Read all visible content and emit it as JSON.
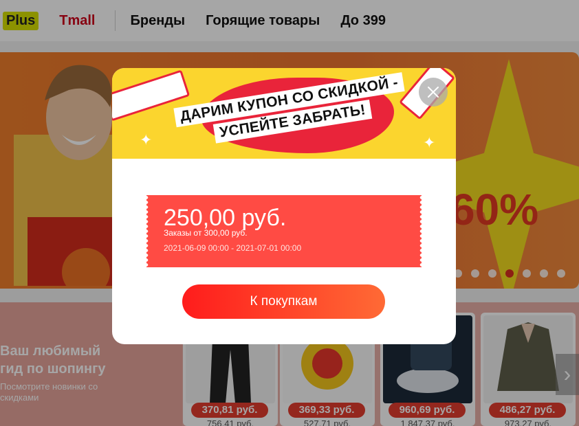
{
  "nav": {
    "items": [
      "Plus",
      "Tmall",
      "Бренды",
      "Горящие товары",
      "До 399"
    ]
  },
  "banner": {
    "percent_text": "60%",
    "slide_count": 7,
    "active_slide": 4
  },
  "promo": {
    "title": "Ваш любимый гид по шопингу",
    "subtitle": "Посмотрите новинки со скидками"
  },
  "products": [
    {
      "price": "370,81 руб.",
      "old_price": "756,41 руб."
    },
    {
      "price": "369,33 руб.",
      "old_price": "527,71 руб."
    },
    {
      "price": "960,69 руб.",
      "old_price": "1 847,37 руб."
    },
    {
      "price": "486,27 руб.",
      "old_price": "973,27 руб."
    }
  ],
  "modal": {
    "title_line1": "ДАРИМ КУПОН СО СКИДКОЙ -",
    "title_line2": "УСПЕЙТЕ ЗАБРАТЬ!",
    "coupon_amount": "250,00 руб.",
    "coupon_condition": "Заказы от 300,00 руб.",
    "coupon_dates": "2021-06-09 00:00 - 2021-07-01 00:00",
    "button_label": "К покупкам"
  },
  "colors": {
    "accent_red": "#ff4b44",
    "tmall_red": "#d0021b",
    "plus_yellow": "#d7e000",
    "modal_header_yellow": "#fbd52e"
  }
}
